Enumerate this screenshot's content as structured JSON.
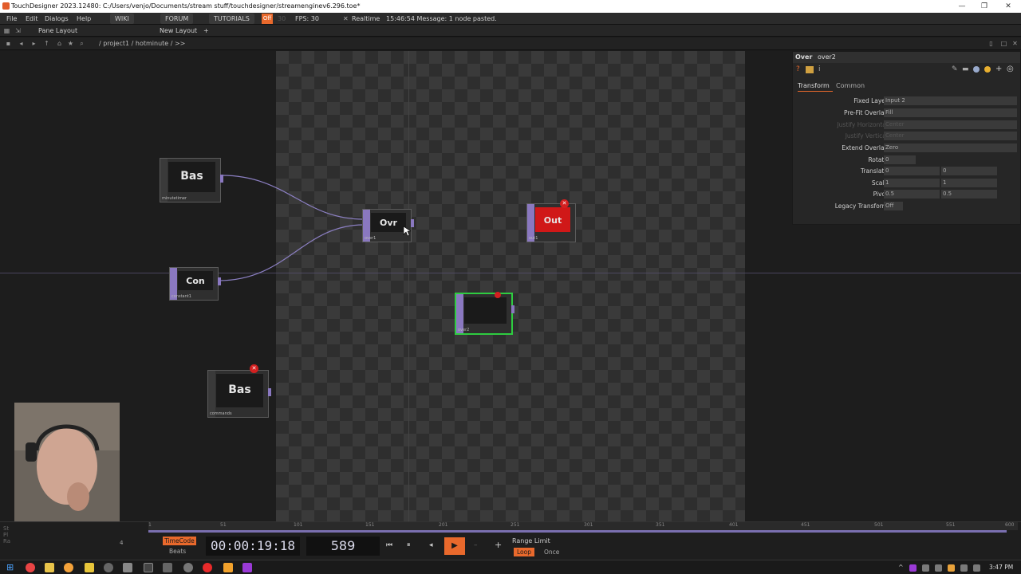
{
  "window": {
    "title": "TouchDesigner 2023.12480: C:/Users/venjo/Documents/stream stuff/touchdesigner/streamenginev6.296.toe*",
    "minimize": "—",
    "maximize": "❐",
    "close": "✕"
  },
  "menu": {
    "items": [
      "File",
      "Edit",
      "Dialogs",
      "Help"
    ],
    "tabs": [
      "WIKI",
      "FORUM",
      "TUTORIALS"
    ],
    "off_badge": "Off",
    "fps_dim": "30",
    "fps_label": "FPS: 30",
    "realtime": "Realtime",
    "message": "15:46:54 Message: 1 node pasted."
  },
  "panebar": {
    "pane_layout": "Pane Layout",
    "new_layout": "New Layout",
    "add": "+"
  },
  "path": {
    "breadcrumb": "/ project1 / hotminute / >>"
  },
  "nodes": {
    "bas1": {
      "name": "Bas",
      "caption": "minutetimer"
    },
    "con1": {
      "name": "Con",
      "caption": "constant1"
    },
    "bas2": {
      "name": "Bas",
      "caption": "commands"
    },
    "ovr1": {
      "name": "Ovr",
      "caption": "over1"
    },
    "out1": {
      "name": "Out",
      "caption": "out1"
    },
    "over2": {
      "name": "",
      "caption": "over2"
    }
  },
  "params": {
    "op_type": "Over",
    "op_name": "over2",
    "tabs": [
      "Transform",
      "Common"
    ],
    "rows": [
      {
        "label": "Fixed Layer",
        "value": "Input 2"
      },
      {
        "label": "Pre-Fit Overlay",
        "value": "Fill"
      },
      {
        "label": "Justify Horizontal",
        "value": "Center",
        "dim": true
      },
      {
        "label": "Justify Vertical",
        "value": "Center",
        "dim": true
      },
      {
        "label": "Extend Overlay",
        "value": "Zero"
      },
      {
        "label": "Rotate",
        "value": "0"
      },
      {
        "label": "Translate",
        "value": "0",
        "value2": "0"
      },
      {
        "label": "Scale",
        "value": "1",
        "value2": "1"
      },
      {
        "label": "Pivot",
        "value": "0.5",
        "value2": "0.5"
      },
      {
        "label": "Legacy Transform",
        "value": "Off"
      }
    ]
  },
  "timeline": {
    "ticks": [
      "1",
      "51",
      "101",
      "151",
      "201",
      "251",
      "301",
      "351",
      "401",
      "451",
      "501",
      "551",
      "600"
    ],
    "timecode_label": "TimeCode",
    "beats_label": "Beats",
    "timecode": "00:00:19:18",
    "frame": "589",
    "range_limit": "Range Limit",
    "loop": "Loop",
    "once": "Once",
    "start_label": "4"
  },
  "taskbar": {
    "clock": "3:47 PM"
  },
  "colors": {
    "accent_orange": "#e9692c",
    "node_purple": "#8a78c0",
    "error_red": "#d32020",
    "selected_green": "#2ecc40"
  }
}
